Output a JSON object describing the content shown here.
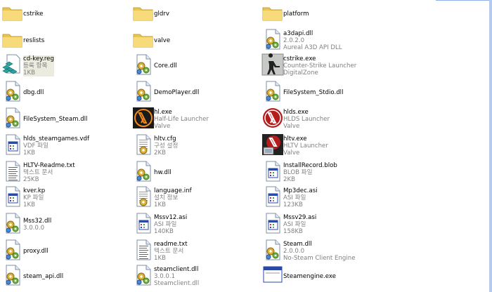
{
  "colors": {
    "folder": "#f3d26b",
    "accent": "#316ac5",
    "selection": "#ecebdf"
  },
  "items": [
    {
      "id": "cstrike",
      "icon": "folder-icon",
      "l1": "cstrike"
    },
    {
      "id": "reslists",
      "icon": "folder-icon",
      "l1": "reslists"
    },
    {
      "id": "cdkey",
      "icon": "registry-file-icon",
      "l1": "cd-key.reg",
      "l2": "등록 항목",
      "l3": "1KB"
    },
    {
      "id": "dbg",
      "icon": "dll-gear-icon",
      "l1": "dbg.dll"
    },
    {
      "id": "fsteam",
      "icon": "dll-gear-icon",
      "l1": "FileSystem_Steam.dll"
    },
    {
      "id": "hlsteamgames",
      "icon": "generic-file-icon",
      "l1": "hlds_steamgames.vdf",
      "l2": "VDF 파일",
      "l3": "1KB"
    },
    {
      "id": "hltvreadme",
      "icon": "text-file-icon",
      "l1": "HLTV-Readme.txt",
      "l2": "텍스트 문서",
      "l3": "25KB"
    },
    {
      "id": "kver",
      "icon": "generic-file-icon",
      "l1": "kver.kp",
      "l2": "KP 파일",
      "l3": "1KB"
    },
    {
      "id": "mss32",
      "icon": "dll-gear-icon",
      "l1": "Mss32.dll",
      "l2": "3.0.0.0"
    },
    {
      "id": "proxy",
      "icon": "dll-gear-icon",
      "l1": "proxy.dll"
    },
    {
      "id": "steamapi",
      "icon": "dll-gear-icon",
      "l1": "steam_api.dll"
    },
    {
      "id": "gldrv",
      "icon": "folder-icon",
      "l1": "gldrv"
    },
    {
      "id": "valve",
      "icon": "folder-icon",
      "l1": "valve"
    },
    {
      "id": "core",
      "icon": "dll-gear-icon",
      "l1": "Core.dll"
    },
    {
      "id": "demoplayer",
      "icon": "dll-gear-icon",
      "l1": "DemoPlayer.dll"
    },
    {
      "id": "hlexe",
      "icon": "half-life-app-icon",
      "l1": "hl.exe",
      "l2": "Half-Life Launcher",
      "l3": "Valve"
    },
    {
      "id": "hltvcfg",
      "icon": "config-file-icon",
      "l1": "hltv.cfg",
      "l2": "구성 설정",
      "l3": "2KB"
    },
    {
      "id": "hw",
      "icon": "dll-gear-icon",
      "l1": "hw.dll"
    },
    {
      "id": "langinf",
      "icon": "config-file-icon",
      "l1": "language.inf",
      "l2": "설치 정보",
      "l3": "1KB"
    },
    {
      "id": "mssv12",
      "icon": "generic-file-icon",
      "l1": "Mssv12.asi",
      "l2": "ASI 파일",
      "l3": "140KB"
    },
    {
      "id": "readme",
      "icon": "text-file-icon",
      "l1": "readme.txt",
      "l2": "텍스트 문서",
      "l3": "1KB"
    },
    {
      "id": "steamclient",
      "icon": "dll-gear-icon",
      "l1": "steamclient.dll",
      "l2": "3.0.0.1",
      "l3": "Steamclient.dll"
    },
    {
      "id": "platform",
      "icon": "folder-icon",
      "l1": "platform"
    },
    {
      "id": "a3dapi",
      "icon": "dll-gear-icon",
      "l1": "a3dapi.dll",
      "l2": "2.0.2.0",
      "l3": "Aureal A3D API DLL"
    },
    {
      "id": "cstrikeexe",
      "icon": "counter-strike-app-icon",
      "l1": "cstrike.exe",
      "l2": "Counter-Strike Launcher",
      "l3": "DigitalZone"
    },
    {
      "id": "fsstdio",
      "icon": "dll-gear-icon",
      "l1": "FileSystem_Stdio.dll"
    },
    {
      "id": "hldsexe",
      "icon": "hlds-app-icon",
      "l1": "hlds.exe",
      "l2": "HLDS Launcher",
      "l3": "Valve"
    },
    {
      "id": "hltvexe",
      "icon": "hltv-app-icon",
      "l1": "hltv.exe",
      "l2": "HLTV Launcher",
      "l3": "Valve"
    },
    {
      "id": "installrecord",
      "icon": "generic-file-icon",
      "l1": "InstallRecord.blob",
      "l2": "BLOB 파일",
      "l3": "2KB"
    },
    {
      "id": "mp3dec",
      "icon": "generic-file-icon",
      "l1": "Mp3dec.asi",
      "l2": "ASI 파일",
      "l3": "123KB"
    },
    {
      "id": "mssv29",
      "icon": "generic-file-icon",
      "l1": "Mssv29.asi",
      "l2": "ASI 파일",
      "l3": "158KB"
    },
    {
      "id": "steamdll",
      "icon": "dll-gear-icon",
      "l1": "Steam.dll",
      "l2": "2.0.0.0",
      "l3": "No-Steam Client Engine"
    },
    {
      "id": "steamengine",
      "icon": "app-window-icon",
      "l1": "Steamengine.exe"
    }
  ]
}
